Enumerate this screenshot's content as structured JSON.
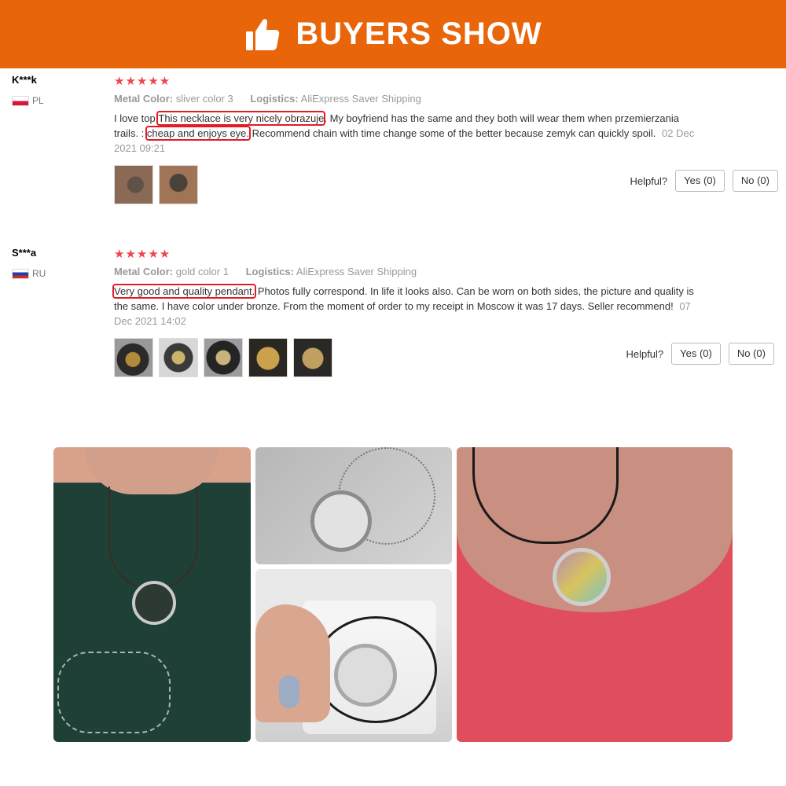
{
  "banner": {
    "title": "BUYERS SHOW",
    "icon": "thumbs-up-icon",
    "background": "#e8650a"
  },
  "reviews": [
    {
      "user": "K***k",
      "country": "PL",
      "stars": "★★★★★",
      "meta": {
        "color_label": "Metal Color:",
        "color_value": "sliver color 3",
        "logistics_label": "Logistics:",
        "logistics_value": "AliExpress Saver Shipping"
      },
      "text_parts": [
        "I love top.",
        "This necklace is very nicely obrazuje",
        ". My boyfriend has the same and they both will wear them when przemierzania trails. :",
        "cheap and enjoys eye.",
        " Recommend chain with time change some of the better because zemyk can quickly spoil."
      ],
      "date": "02 Dec 2021 09:21",
      "photo_count": 2,
      "helpful_label": "Helpful?",
      "yes_label": "Yes (0)",
      "no_label": "No (0)"
    },
    {
      "user": "S***a",
      "country": "RU",
      "stars": "★★★★★",
      "meta": {
        "color_label": "Metal Color:",
        "color_value": "gold color 1",
        "logistics_label": "Logistics:",
        "logistics_value": "AliExpress Saver Shipping"
      },
      "text_parts": [
        "Very good and quality pendant.",
        " Photos fully correspond. In life it looks also. Can be worn on both sides, the picture and quality is the same. I have color under bronze. From the moment of order to my receipt in Moscow it was 17 days. Seller recommend!"
      ],
      "date": "07 Dec 2021 14:02",
      "photo_count": 5,
      "helpful_label": "Helpful?",
      "yes_label": "Yes (0)",
      "no_label": "No (0)"
    }
  ],
  "colors": {
    "star": "#f2434e",
    "highlight": "#e51b24",
    "muted_text": "#999999"
  }
}
